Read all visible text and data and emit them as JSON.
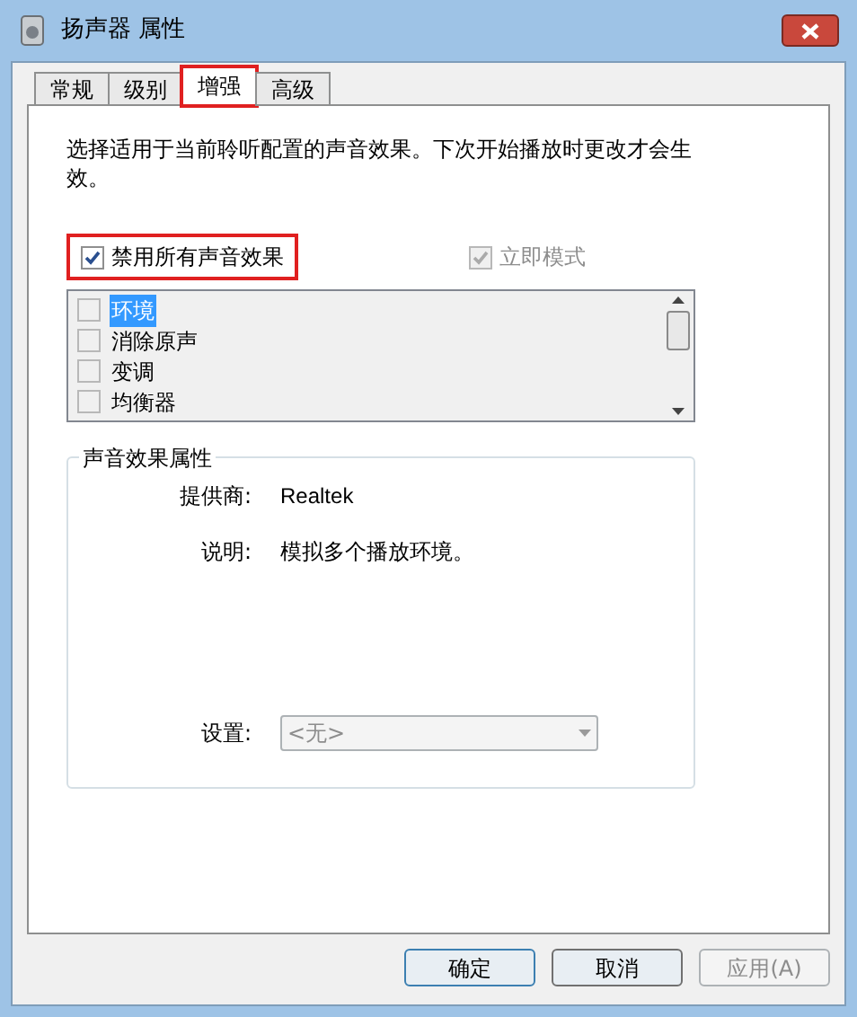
{
  "window": {
    "title": "扬声器 属性"
  },
  "tabs": [
    {
      "label": "常规",
      "selected": false,
      "highlighted": false
    },
    {
      "label": "级别",
      "selected": false,
      "highlighted": false
    },
    {
      "label": "增强",
      "selected": true,
      "highlighted": true
    },
    {
      "label": "高级",
      "selected": false,
      "highlighted": false
    }
  ],
  "description": "选择适用于当前聆听配置的声音效果。下次开始播放时更改才会生效。",
  "disable_all": {
    "label": "禁用所有声音效果",
    "checked": true,
    "highlighted": true
  },
  "immediate_mode": {
    "label": "立即模式",
    "checked": true,
    "disabled": true
  },
  "effects": [
    {
      "label": "环境",
      "checked": false,
      "selected": true,
      "disabled": true
    },
    {
      "label": "消除原声",
      "checked": false,
      "selected": false,
      "disabled": true
    },
    {
      "label": "变调",
      "checked": false,
      "selected": false,
      "disabled": true
    },
    {
      "label": "均衡器",
      "checked": false,
      "selected": false,
      "disabled": true
    }
  ],
  "properties": {
    "title": "声音效果属性",
    "provider_label": "提供商:",
    "provider": "Realtek",
    "description_label": "说明:",
    "description": "模拟多个播放环境。",
    "settings_label": "设置:",
    "settings_value": "<无>",
    "settings_disabled": true
  },
  "buttons": [
    {
      "label": "确定",
      "disabled": false,
      "default": true
    },
    {
      "label": "取消",
      "disabled": false,
      "default": false
    },
    {
      "label": "应用(A)",
      "disabled": true,
      "default": false
    }
  ]
}
